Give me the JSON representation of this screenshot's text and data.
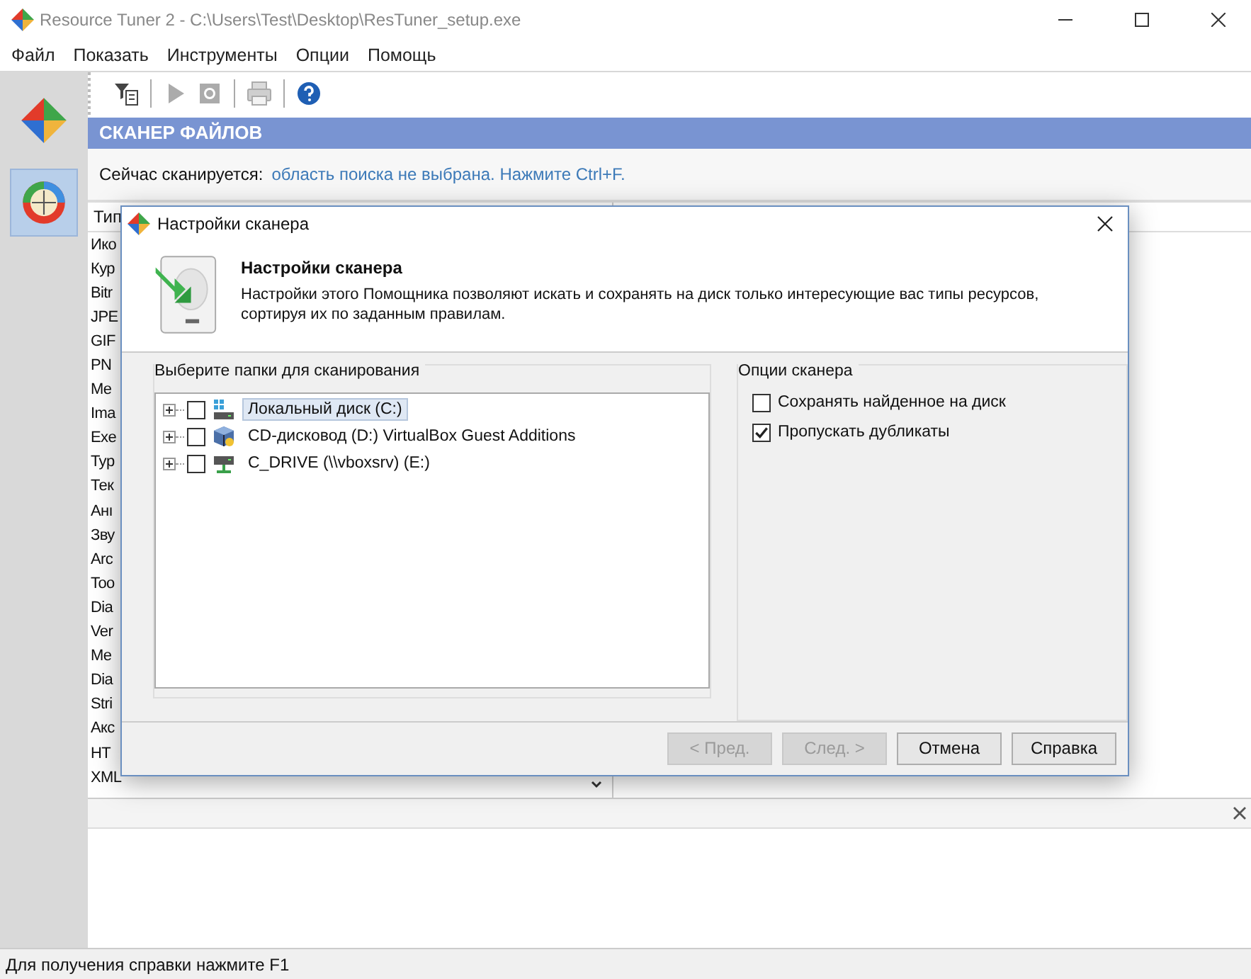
{
  "window": {
    "title": "Resource Tuner 2 - C:\\Users\\Test\\Desktop\\ResTuner_setup.exe"
  },
  "menu": [
    {
      "label": "Файл"
    },
    {
      "label": "Показать"
    },
    {
      "label": "Инструменты"
    },
    {
      "label": "Опции"
    },
    {
      "label": "Помощь"
    }
  ],
  "sidebar": {
    "items": [
      {
        "kind": "resources",
        "selected": false
      },
      {
        "kind": "scanner",
        "selected": true
      }
    ]
  },
  "toolbar": [
    {
      "kind": "filter",
      "disabled": false
    },
    {
      "kind": "play",
      "disabled": true
    },
    {
      "kind": "stop",
      "disabled": true
    },
    {
      "kind": "print",
      "disabled": true
    },
    {
      "kind": "help",
      "disabled": false
    }
  ],
  "panel": {
    "title": "СКАНЕР ФАЙЛОВ",
    "status_label": "Сейчас сканируется:",
    "status_value": "область поиска не выбрана. Нажмите Ctrl+F."
  },
  "table": {
    "columns": [
      "Тип"
    ],
    "rows": [
      "Ико",
      "Кур",
      "Bitr",
      "JPE",
      "GIF",
      "PN",
      "Me",
      "Ima",
      "Exe",
      "Typ",
      "Тек",
      "Анı",
      "Зву",
      "Arc",
      "Too",
      "Dia",
      "Ver",
      "Me",
      "Dia",
      "Stri",
      "Акс",
      "HT",
      "XML"
    ]
  },
  "dialog": {
    "title": "Настройки сканера",
    "heading": "Настройки сканера",
    "description": "Настройки этого Помощника позволяют искать и сохранять на диск только интересующие вас типы ресурсов, сортируя их по заданным правилам.",
    "folders": {
      "title": "Выберите папки для сканирования",
      "items": [
        {
          "label": "Локальный диск (C:)",
          "kind": "disk",
          "checked": false,
          "selected": true
        },
        {
          "label": "CD-дисковод (D:) VirtualBox Guest Additions",
          "kind": "cd",
          "checked": false,
          "selected": false
        },
        {
          "label": "C_DRIVE (\\\\vboxsrv) (E:)",
          "kind": "network",
          "checked": false,
          "selected": false
        }
      ]
    },
    "options": {
      "title": "Опции сканера",
      "items": [
        {
          "label": "Сохранять найденное на диск",
          "checked": false
        },
        {
          "label": "Пропускать дубликаты",
          "checked": true
        }
      ]
    },
    "buttons": [
      {
        "label": "< Пред.",
        "disabled": true
      },
      {
        "label": "След. >",
        "disabled": true
      },
      {
        "label": "Отмена",
        "disabled": false
      },
      {
        "label": "Справка",
        "disabled": false
      }
    ]
  },
  "status_bar": "Для получения справки нажмите F1"
}
